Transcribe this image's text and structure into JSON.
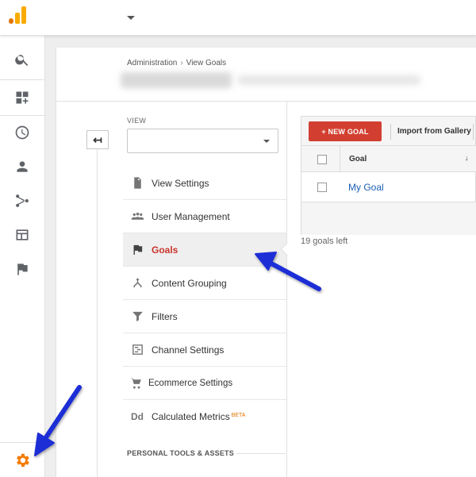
{
  "app": {
    "name": "Google Analytics"
  },
  "nav_rail": {
    "items": [
      {
        "name": "search-icon"
      },
      {
        "name": "customization-icon"
      },
      {
        "name": "realtime-clock-icon"
      },
      {
        "name": "audience-person-icon"
      },
      {
        "name": "acquisition-icon"
      },
      {
        "name": "behavior-icon"
      },
      {
        "name": "conversions-flag-icon"
      }
    ],
    "admin": "admin-gear-icon"
  },
  "breadcrumb": {
    "first": "Administration",
    "separator": "›",
    "second": "View Goals"
  },
  "view_column": {
    "label": "VIEW",
    "selected_view": "",
    "menu": [
      {
        "label": "View Settings",
        "icon": "document-icon"
      },
      {
        "label": "User Management",
        "icon": "people-icon"
      },
      {
        "label": "Goals",
        "icon": "flag-icon",
        "active": true
      },
      {
        "label": "Content Grouping",
        "icon": "content-grouping-icon"
      },
      {
        "label": "Filters",
        "icon": "filter-icon"
      },
      {
        "label": "Channel Settings",
        "icon": "channel-settings-icon"
      },
      {
        "label": "Ecommerce Settings",
        "icon": "cart-icon"
      },
      {
        "label": "Calculated Metrics",
        "icon": "dd-icon",
        "badge": "BETA"
      }
    ],
    "section_title": "PERSONAL TOOLS & ASSETS"
  },
  "goals_panel": {
    "new_goal_label": "+ NEW GOAL",
    "import_label": "Import from Gallery",
    "column_header": "Goal",
    "sort_indicator": "↓",
    "rows": [
      {
        "name": "My Goal"
      }
    ],
    "remaining": "19 goals left"
  },
  "colors": {
    "accent_red": "#d23f31",
    "active_text": "#c8352b",
    "admin_orange": "#f57c00",
    "annotation_arrow": "#1f2fd6",
    "link_blue": "#1a5fb4"
  }
}
